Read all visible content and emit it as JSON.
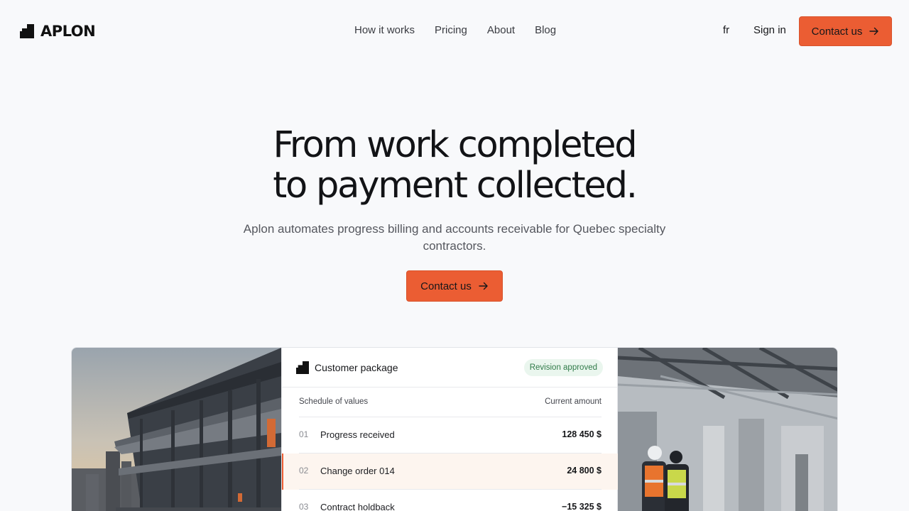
{
  "brand": {
    "name": "APLON"
  },
  "nav": {
    "links": [
      "How it works",
      "Pricing",
      "About",
      "Blog"
    ],
    "lang": "fr",
    "signin": "Sign in",
    "cta": "Contact us"
  },
  "hero": {
    "title_line1": "From work completed",
    "title_line2": "to payment collected.",
    "subtitle": "Aplon automates progress billing and accounts receivable for Quebec specialty contractors.",
    "cta": "Contact us"
  },
  "card": {
    "title": "Customer package",
    "badge": "Revision approved",
    "col_left": "Schedule of values",
    "col_right": "Current amount",
    "rows": [
      {
        "num": "01",
        "name": "Progress received",
        "amount": "128 450 $"
      },
      {
        "num": "02",
        "name": "Change order 014",
        "amount": "24 800 $"
      },
      {
        "num": "03",
        "name": "Contract holdback",
        "amount": "−15 325 $"
      }
    ]
  },
  "colors": {
    "accent": "#eb5d33",
    "badge_bg": "#eaf6ee",
    "badge_text": "#2f7a48"
  },
  "icons": {
    "cta_arrow": "arrow-right-icon",
    "logo": "aplon-logo-icon"
  }
}
